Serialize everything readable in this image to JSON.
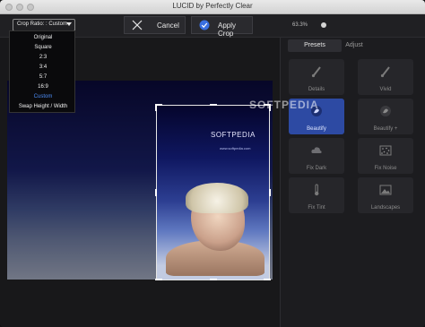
{
  "window": {
    "title": "LUCID by Perfectly Clear"
  },
  "toolbar": {
    "crop_ratio_label": "Crop Ratio: : Custom",
    "cancel_label": "Cancel",
    "apply_label": "Apply Crop",
    "zoom_label": "63.3%"
  },
  "crop_menu": {
    "items": [
      "Original",
      "Square",
      "2:3",
      "3:4",
      "5:7",
      "16:9",
      "Custom",
      "Swap Height / Width"
    ],
    "selected": "Custom"
  },
  "image": {
    "watermark": "SOFTPEDIA",
    "overlay_title": "SOFTPEDIA",
    "overlay_site": "www.softpedia.com"
  },
  "panel": {
    "tabs": [
      "Presets",
      "Adjust"
    ],
    "active_tab": "Presets",
    "presets": [
      {
        "label": "Details",
        "icon": "brush-icon",
        "selected": false
      },
      {
        "label": "Vivid",
        "icon": "brush-icon",
        "selected": false
      },
      {
        "label": "Beautify",
        "icon": "beautify-icon",
        "selected": true
      },
      {
        "label": "Beautify +",
        "icon": "beautify-plus-icon",
        "selected": false
      },
      {
        "label": "Fix Dark",
        "icon": "cloud-icon",
        "selected": false
      },
      {
        "label": "Fix Noise",
        "icon": "noise-icon",
        "selected": false
      },
      {
        "label": "Fix Tint",
        "icon": "thermometer-icon",
        "selected": false
      },
      {
        "label": "Landscapes",
        "icon": "landscape-icon",
        "selected": false
      }
    ]
  },
  "colors": {
    "accent": "#2d4aa3",
    "selected_menu": "#4d8df6",
    "apply_check": "#3a6fe0"
  }
}
